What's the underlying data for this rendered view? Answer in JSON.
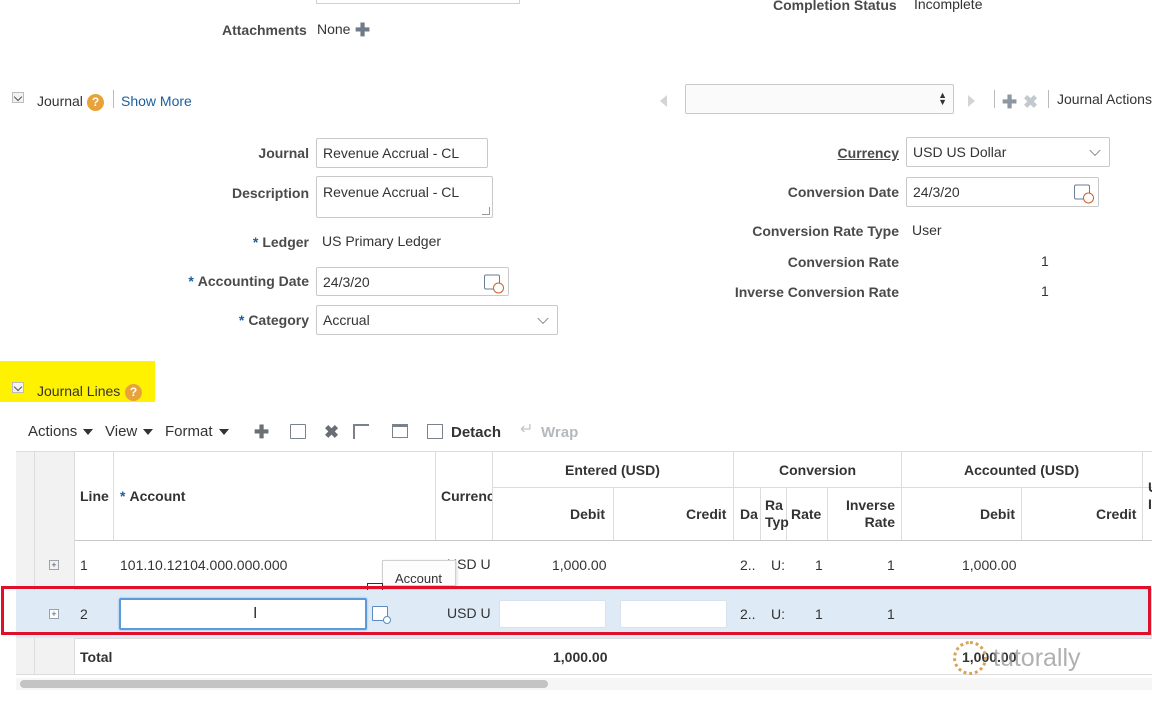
{
  "header": {
    "attachments_label": "Attachments",
    "attachments_value": "None",
    "completion_status_label": "Completion Status",
    "completion_status_value": "Incomplete"
  },
  "journal_section": {
    "title": "Journal",
    "show_more": "Show More",
    "actions_label": "Journal Actions",
    "help": "?"
  },
  "form": {
    "journal_label": "Journal",
    "journal_value": "Revenue Accrual - CL",
    "description_label": "Description",
    "description_value": "Revenue Accrual - CL",
    "ledger_label": "Ledger",
    "ledger_value": "US Primary Ledger",
    "accounting_date_label": "Accounting Date",
    "accounting_date_value": "24/3/20",
    "category_label": "Category",
    "category_value": "Accrual",
    "currency_label": "Currency",
    "currency_value": "USD US Dollar",
    "conversion_date_label": "Conversion Date",
    "conversion_date_value": "24/3/20",
    "conversion_rate_type_label": "Conversion Rate Type",
    "conversion_rate_type_value": "User",
    "conversion_rate_label": "Conversion Rate",
    "conversion_rate_value": "1",
    "inverse_conversion_rate_label": "Inverse Conversion Rate",
    "inverse_conversion_rate_value": "1",
    "required_mark": "*"
  },
  "lines_section": {
    "title": "Journal Lines",
    "help": "?"
  },
  "toolbar": {
    "actions": "Actions",
    "view": "View",
    "format": "Format",
    "detach": "Detach",
    "wrap": "Wrap"
  },
  "table": {
    "headers": {
      "line": "Line",
      "account": "Account",
      "currency": "Currenc",
      "entered_group": "Entered (USD)",
      "conversion_group": "Conversion",
      "accounted_group": "Accounted (USD)",
      "debit": "Debit",
      "credit": "Credit",
      "date_short": "Da",
      "rate_type_1": "Ra",
      "rate_type_2": "Typ",
      "rate": "Rate",
      "inverse_rate_1": "Inverse",
      "inverse_rate_2": "Rate",
      "accounted_debit": "Debit",
      "accounted_credit": "Credit",
      "cut_1": "U",
      "cut_2": "I"
    },
    "rows": [
      {
        "line": "1",
        "account": "101.10.12104.000.000.000",
        "currency": "USD U:",
        "entered_debit": "1,000.00",
        "entered_credit": "",
        "date": "2..",
        "rate_type": "U:",
        "rate": "1",
        "inverse_rate": "1",
        "accounted_debit": "1,000.00",
        "accounted_credit": ""
      },
      {
        "line": "2",
        "account": "",
        "currency": "USD U:",
        "entered_debit": "",
        "entered_credit": "",
        "date": "2..",
        "rate_type": "U:",
        "rate": "1",
        "inverse_rate": "1",
        "accounted_debit": "",
        "accounted_credit": ""
      }
    ],
    "total_label": "Total",
    "total_entered_debit": "1,000.00",
    "total_accounted_debit": "1,000.00",
    "tooltip": "Account"
  },
  "watermark": {
    "text": "tutorally"
  },
  "colors": {
    "highlight_yellow": "#fff200",
    "selection_red": "#e0102a",
    "row_selected_bg": "#dfeaf7",
    "link_blue": "#1b5e9e"
  }
}
